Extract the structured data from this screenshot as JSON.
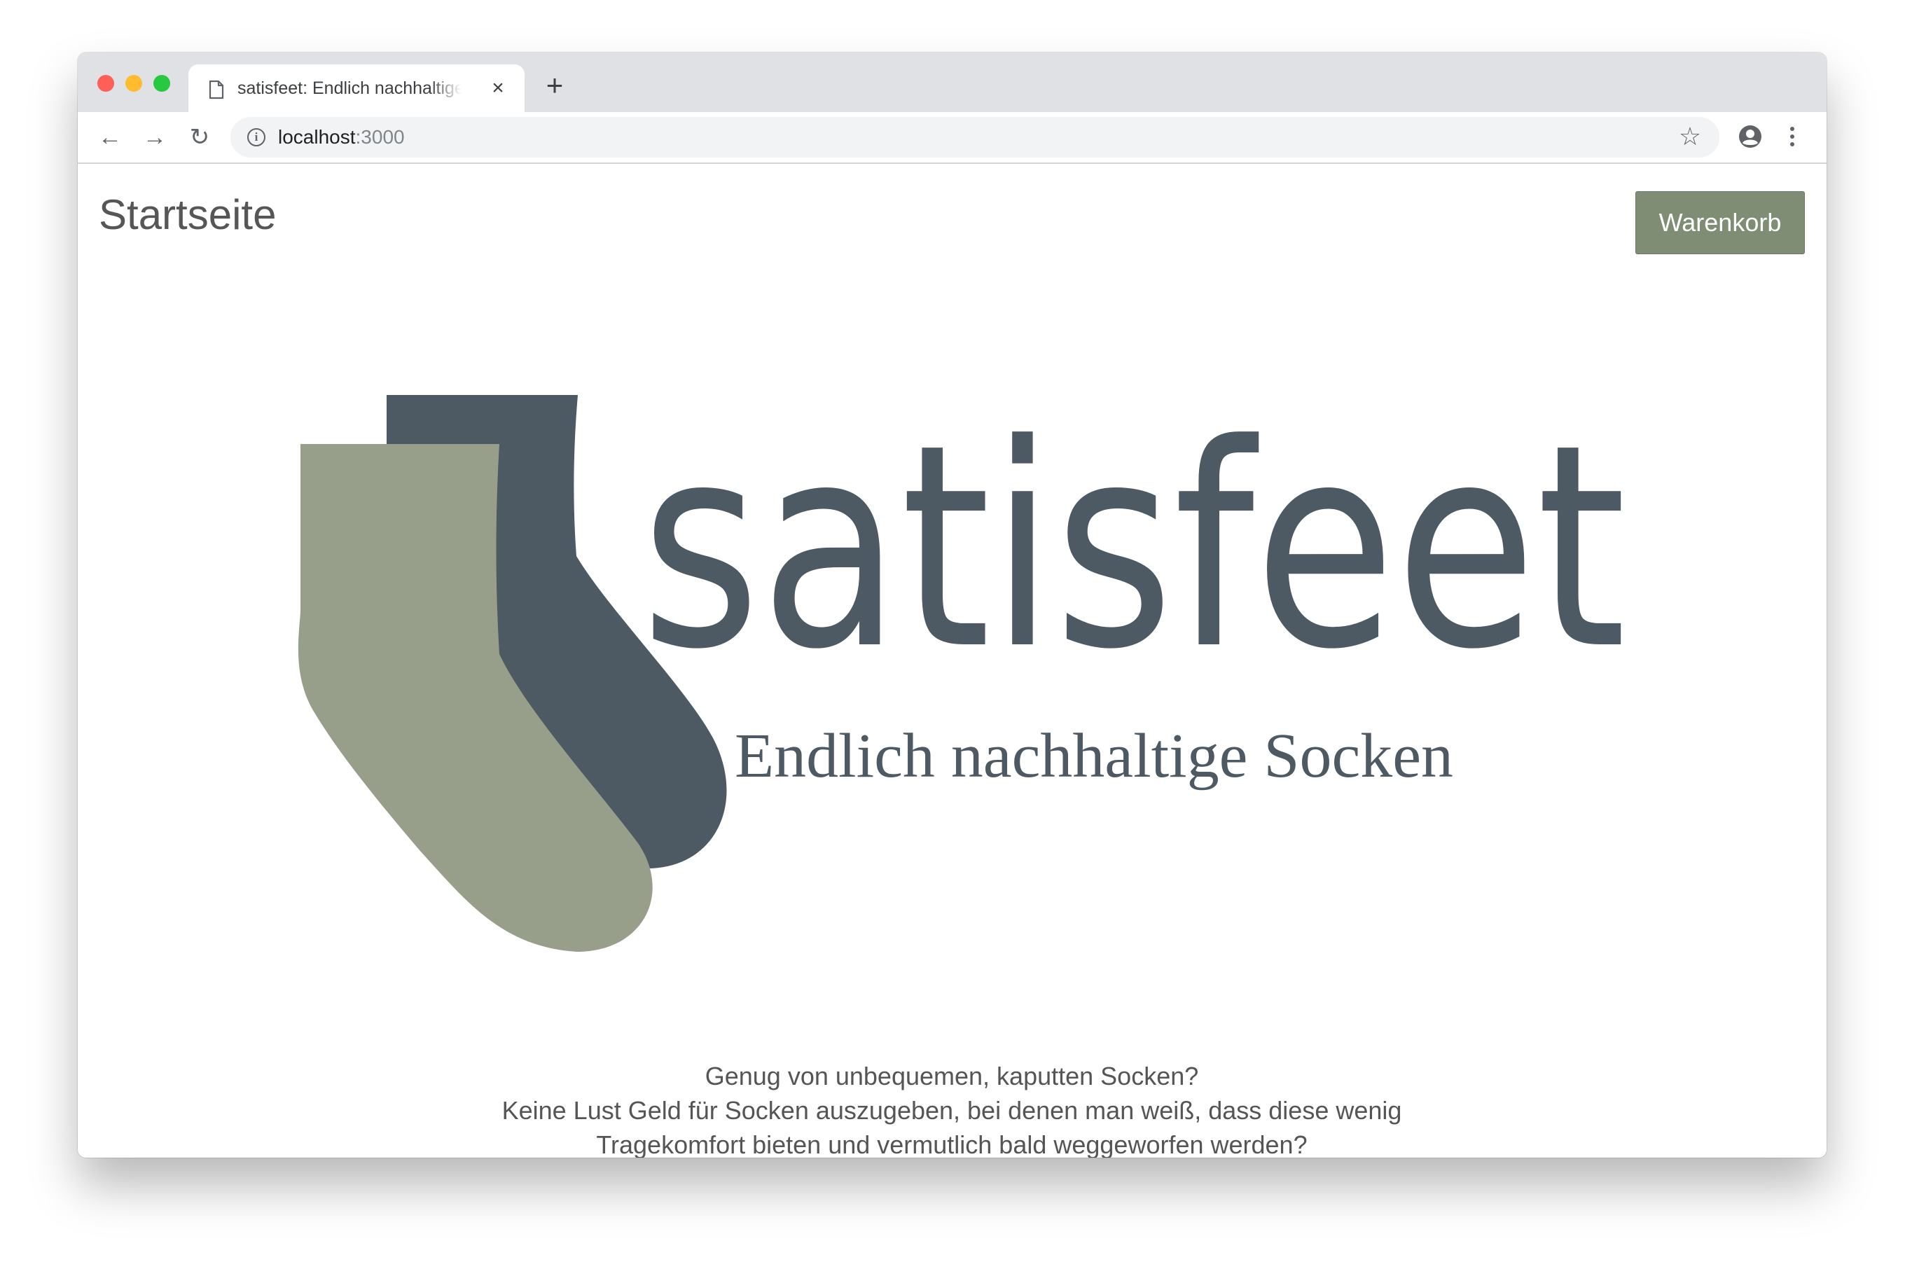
{
  "browser": {
    "tab": {
      "title": "satisfeet: Endlich nachhaltige Socken",
      "close_glyph": "×",
      "doc_icon": "document-icon"
    },
    "new_tab_glyph": "+",
    "nav": {
      "back_glyph": "←",
      "forward_glyph": "→",
      "reload_glyph": "↻"
    },
    "address": {
      "host": "localhost",
      "port": ":3000",
      "info_glyph": "i",
      "star_glyph": "☆"
    }
  },
  "page": {
    "title": "Startseite",
    "cart_label": "Warenkorb",
    "colors": {
      "accent": "#7e8d73",
      "sock_light": "#979f8a",
      "sock_dark": "#4d5963"
    },
    "logo": {
      "wordmark": "satisfeet",
      "tagline": "Endlich nachhaltige Socken"
    },
    "intro": [
      "Genug von unbequemen, kaputten Socken?",
      "Keine Lust Geld für Socken auszugeben, bei denen man weiß, dass diese wenig Tragekomfort bieten und vermutlich bald weggeworfen werden?"
    ]
  }
}
